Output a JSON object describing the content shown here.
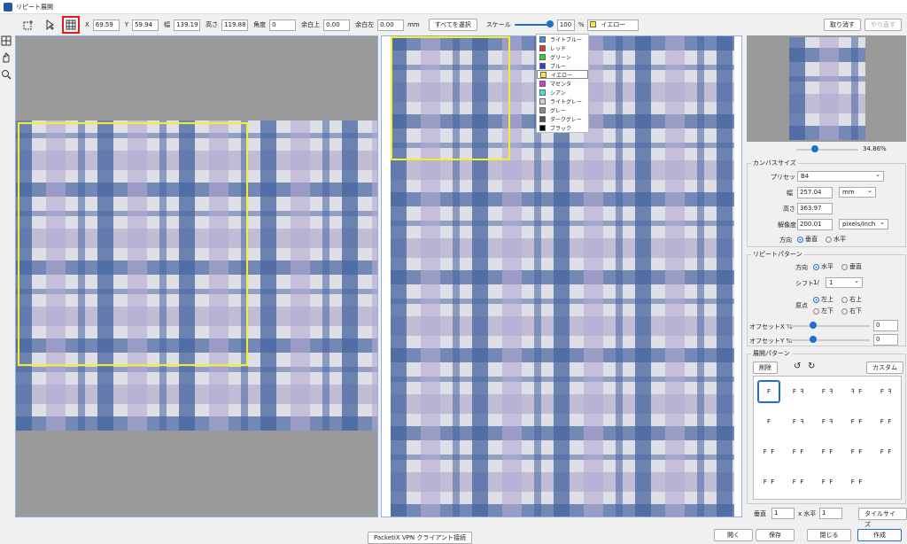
{
  "window": {
    "title": "リピート展開"
  },
  "toolbar": {
    "x_label": "X",
    "x_value": "69.59",
    "y_label": "Y",
    "y_value": "59.94",
    "width_label": "幅",
    "width_value": "139.19",
    "height_label": "高さ",
    "height_value": "119.88",
    "angle_label": "角度",
    "angle_value": "0",
    "margin_top_label": "余白上",
    "margin_top_value": "0.00",
    "margin_left_label": "余白左",
    "margin_left_value": "0.00",
    "unit": "mm",
    "select_all_label": "すべてを選択",
    "scale_label": "スケール",
    "scale_value": "100",
    "percent": "%",
    "scale_fraction": 0.95,
    "color_selected": "イエロー",
    "undo_label": "取り消す",
    "redo_label": "やり直す"
  },
  "color_menu": [
    {
      "label": "ライトブルー",
      "color": "#3b8ee6"
    },
    {
      "label": "レッド",
      "color": "#e53333"
    },
    {
      "label": "グリーン",
      "color": "#33d133"
    },
    {
      "label": "ブルー",
      "color": "#2f3fe0"
    },
    {
      "label": "イエロー",
      "color": "#f5ee2a"
    },
    {
      "label": "マゼンタ",
      "color": "#e033e0"
    },
    {
      "label": "シアン",
      "color": "#3fe6e6"
    },
    {
      "label": "ライトグレー",
      "color": "#cfcfcf"
    },
    {
      "label": "グレー",
      "color": "#8a8a8a"
    },
    {
      "label": "ダークグレー",
      "color": "#555555"
    },
    {
      "label": "ブラック",
      "color": "#000000"
    }
  ],
  "preview": {
    "zoom": "34.86%",
    "zoom_fraction": 0.3
  },
  "canvas_size": {
    "title": "カンバスサイズ",
    "preset_label": "プリセット",
    "preset_value": "B4",
    "width_label": "幅",
    "width_value": "257.04",
    "width_unit": "mm",
    "height_label": "高さ",
    "height_value": "363.97",
    "resolution_label": "解像度",
    "resolution_value": "200.01",
    "resolution_unit": "pixels/inch",
    "direction_label": "方向",
    "direction_vertical": "垂直",
    "direction_horizontal": "水平"
  },
  "repeat_pattern": {
    "title": "リピートパターン",
    "direction_label": "方向",
    "direction_horizontal": "水平",
    "direction_vertical": "垂直",
    "shift_label": "シフト",
    "shift_prefix": "1/",
    "shift_value": "1",
    "origin_label": "原点",
    "origin_tl": "左上",
    "origin_tr": "右上",
    "origin_bl": "左下",
    "origin_br": "右下",
    "offset_x_label": "オフセットX %",
    "offset_x_value": "0",
    "offset_x_fraction": 0.3,
    "offset_y_label": "オフセットY %",
    "offset_y_value": "0",
    "offset_y_fraction": 0.3
  },
  "expand_pattern": {
    "title": "展開パターン",
    "delete_label": "削除",
    "custom_label": "カスタム",
    "cells": [
      "F",
      "F ꟻ",
      "F ꟻ",
      "ꟻ F",
      "F ꟻ",
      "F",
      "F ꟻ",
      "F ꟻ",
      "F F",
      "F F",
      "F F",
      "F F",
      "F F",
      "F F",
      "F F",
      "F F",
      "F F",
      "F F",
      "F F"
    ]
  },
  "tile": {
    "vertical_label": "垂直",
    "vertical_value": "1",
    "times_label": "x 水平",
    "horizontal_value": "1",
    "tile_size_label": "タイルサイズ"
  },
  "footer": {
    "taskbar_label": "PacketiX VPN クライアント接続",
    "open_label": "開く",
    "save_label": "保存",
    "close_label": "閉じる",
    "create_label": "作成"
  }
}
